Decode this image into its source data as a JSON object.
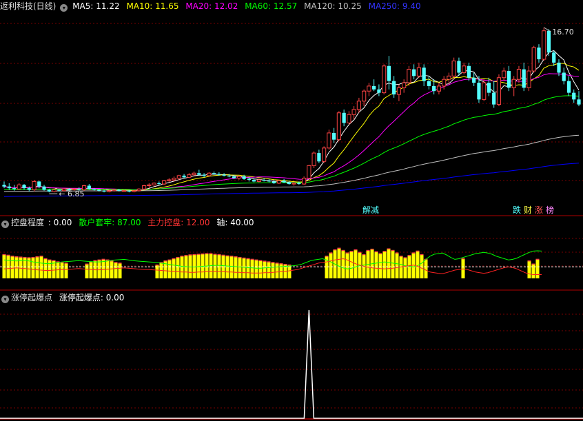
{
  "stock_name": "返利科技(日线)",
  "colors": {
    "bg": "#000000",
    "up": "#ff4444",
    "down": "#54ffff",
    "ma5": "#ffffff",
    "ma10": "#ffff00",
    "ma20": "#ff00ff",
    "ma60": "#00ff00",
    "ma120": "#c0c0c0",
    "ma250": "#0000ff",
    "grid": "#7a0000",
    "separator": "#b00000"
  },
  "top_legend": [
    {
      "label": "MA5: 11.22",
      "color": "#ffffff"
    },
    {
      "label": "MA10: 11.65",
      "color": "#ffff00"
    },
    {
      "label": "MA20: 12.02",
      "color": "#ff00ff"
    },
    {
      "label": "MA60: 12.57",
      "color": "#00ff00"
    },
    {
      "label": "MA120: 10.25",
      "color": "#c0c0c0"
    },
    {
      "label": "MA250: 9.40",
      "color": "#3333ff"
    }
  ],
  "mid_legend": {
    "title": "控盘程度",
    "items": [
      {
        "label": ": 0.00",
        "color": "#ffffff"
      },
      {
        "label": "散户套牢: 87.00",
        "color": "#00ff00"
      },
      {
        "label": "主力控盘: 12.00",
        "color": "#ff3333"
      },
      {
        "label": "轴: 40.00",
        "color": "#ffffff"
      }
    ]
  },
  "bot_legend": {
    "title": "涨停起爆点",
    "items": [
      {
        "label": "涨停起爆点: 0.00",
        "color": "#ffffff"
      }
    ]
  },
  "annotations": {
    "high_label": "16.70",
    "low_label": "6.85",
    "tag1": "解减",
    "tag2": [
      "跌",
      "财",
      "涨",
      "榜"
    ]
  },
  "chart_data": [
    {
      "type": "candlestick",
      "title": "返利科技(日线)",
      "ylim": [
        5.5,
        17.6
      ],
      "high": 16.7,
      "low": 6.85,
      "note": "ohlc = [open, high, low, close] per daily bar",
      "ohlc": [
        [
          7.3,
          7.5,
          7.1,
          7.2
        ],
        [
          7.2,
          7.4,
          7.0,
          7.1
        ],
        [
          7.1,
          7.3,
          6.95,
          7.05
        ],
        [
          7.05,
          7.4,
          7.0,
          7.3
        ],
        [
          7.3,
          7.35,
          7.0,
          7.1
        ],
        [
          7.1,
          7.2,
          6.9,
          7.0
        ],
        [
          7.0,
          7.6,
          6.9,
          7.5
        ],
        [
          7.5,
          7.55,
          7.1,
          7.2
        ],
        [
          7.2,
          7.3,
          6.95,
          7.0
        ],
        [
          7.0,
          7.05,
          6.85,
          6.9
        ],
        [
          6.9,
          7.05,
          6.85,
          7.0
        ],
        [
          7.0,
          7.05,
          6.9,
          6.95
        ],
        [
          6.95,
          7.1,
          6.9,
          7.05
        ],
        [
          7.05,
          7.1,
          6.95,
          7.0
        ],
        [
          7.0,
          7.1,
          6.95,
          7.05
        ],
        [
          7.05,
          7.15,
          6.95,
          7.0
        ],
        [
          7.0,
          7.3,
          6.95,
          7.25
        ],
        [
          7.25,
          7.35,
          7.0,
          7.05
        ],
        [
          7.05,
          7.1,
          6.95,
          7.0
        ],
        [
          7.0,
          7.05,
          6.9,
          6.95
        ],
        [
          6.95,
          7.0,
          6.85,
          6.9
        ],
        [
          6.9,
          7.0,
          6.85,
          6.95
        ],
        [
          6.95,
          7.05,
          6.9,
          7.0
        ],
        [
          7.0,
          7.05,
          6.9,
          6.95
        ],
        [
          6.95,
          7.0,
          6.9,
          6.95
        ],
        [
          6.95,
          7.0,
          6.85,
          6.9
        ],
        [
          6.9,
          7.0,
          6.85,
          6.95
        ],
        [
          6.95,
          7.1,
          6.9,
          7.05
        ],
        [
          7.05,
          7.3,
          7.0,
          7.25
        ],
        [
          7.25,
          7.4,
          7.1,
          7.3
        ],
        [
          7.3,
          7.45,
          7.2,
          7.4
        ],
        [
          7.4,
          7.5,
          7.3,
          7.35
        ],
        [
          7.35,
          7.6,
          7.3,
          7.55
        ],
        [
          7.55,
          7.7,
          7.45,
          7.6
        ],
        [
          7.6,
          7.8,
          7.5,
          7.7
        ],
        [
          7.7,
          7.9,
          7.6,
          7.85
        ],
        [
          7.85,
          7.95,
          7.7,
          7.75
        ],
        [
          7.75,
          8.0,
          7.7,
          7.9
        ],
        [
          7.9,
          8.1,
          7.8,
          8.0
        ],
        [
          8.0,
          8.2,
          7.85,
          7.9
        ],
        [
          7.9,
          8.0,
          7.75,
          7.85
        ],
        [
          7.85,
          8.05,
          7.8,
          8.0
        ],
        [
          8.0,
          8.1,
          7.9,
          7.95
        ],
        [
          7.95,
          8.05,
          7.85,
          7.9
        ],
        [
          7.9,
          8.0,
          7.8,
          7.85
        ],
        [
          7.85,
          7.95,
          7.75,
          7.8
        ],
        [
          7.8,
          7.9,
          7.65,
          7.7
        ],
        [
          7.7,
          7.85,
          7.6,
          7.8
        ],
        [
          7.8,
          7.9,
          7.6,
          7.65
        ],
        [
          7.65,
          7.75,
          7.5,
          7.6
        ],
        [
          7.6,
          7.7,
          7.45,
          7.5
        ],
        [
          7.5,
          7.65,
          7.45,
          7.6
        ],
        [
          7.6,
          7.7,
          7.5,
          7.55
        ],
        [
          7.55,
          7.65,
          7.45,
          7.5
        ],
        [
          7.5,
          7.6,
          7.35,
          7.4
        ],
        [
          7.4,
          7.6,
          7.35,
          7.55
        ],
        [
          7.55,
          7.65,
          7.4,
          7.45
        ],
        [
          7.45,
          7.55,
          7.3,
          7.35
        ],
        [
          7.35,
          7.45,
          7.25,
          7.4
        ],
        [
          7.4,
          7.5,
          7.3,
          7.35
        ],
        [
          7.35,
          7.8,
          7.3,
          7.7
        ],
        [
          7.7,
          8.5,
          7.65,
          8.45
        ],
        [
          8.45,
          9.3,
          8.3,
          9.2
        ],
        [
          9.2,
          9.4,
          8.6,
          8.7
        ],
        [
          8.7,
          9.6,
          8.6,
          9.5
        ],
        [
          9.5,
          10.6,
          9.4,
          10.4
        ],
        [
          10.4,
          10.7,
          9.8,
          10.0
        ],
        [
          10.0,
          11.7,
          9.9,
          11.6
        ],
        [
          11.6,
          11.8,
          10.8,
          11.0
        ],
        [
          11.0,
          11.7,
          10.9,
          11.5
        ],
        [
          11.5,
          12.0,
          11.2,
          11.8
        ],
        [
          11.8,
          12.5,
          11.6,
          12.3
        ],
        [
          12.3,
          13.0,
          12.0,
          12.9
        ],
        [
          12.9,
          13.4,
          12.6,
          13.2
        ],
        [
          13.2,
          13.6,
          12.9,
          13.0
        ],
        [
          13.0,
          13.3,
          12.6,
          12.8
        ],
        [
          12.8,
          14.5,
          12.7,
          14.4
        ],
        [
          14.4,
          15.0,
          13.0,
          13.5
        ],
        [
          13.5,
          13.8,
          12.5,
          12.7
        ],
        [
          12.7,
          13.3,
          12.3,
          13.1
        ],
        [
          13.1,
          13.6,
          12.8,
          13.4
        ],
        [
          13.4,
          14.4,
          13.2,
          14.2
        ],
        [
          14.2,
          14.5,
          13.6,
          13.8
        ],
        [
          13.8,
          14.6,
          13.7,
          14.3
        ],
        [
          14.3,
          14.5,
          13.2,
          13.5
        ],
        [
          13.5,
          13.8,
          13.0,
          13.2
        ],
        [
          13.2,
          13.6,
          12.7,
          12.9
        ],
        [
          12.9,
          13.4,
          12.7,
          13.2
        ],
        [
          13.2,
          13.8,
          13.0,
          13.6
        ],
        [
          13.6,
          14.0,
          13.3,
          13.8
        ],
        [
          13.8,
          14.9,
          13.6,
          14.7
        ],
        [
          14.7,
          14.9,
          13.8,
          14.0
        ],
        [
          14.0,
          14.6,
          13.9,
          14.4
        ],
        [
          14.4,
          14.6,
          13.5,
          13.7
        ],
        [
          13.7,
          14.0,
          13.2,
          13.4
        ],
        [
          13.4,
          13.8,
          12.2,
          12.4
        ],
        [
          12.4,
          13.6,
          12.3,
          13.4
        ],
        [
          13.4,
          13.7,
          12.6,
          12.8
        ],
        [
          12.8,
          13.5,
          11.9,
          12.1
        ],
        [
          12.1,
          13.9,
          12.0,
          13.7
        ],
        [
          13.7,
          14.3,
          13.5,
          14.1
        ],
        [
          14.1,
          14.4,
          12.9,
          13.1
        ],
        [
          13.1,
          13.8,
          12.6,
          13.6
        ],
        [
          13.6,
          14.4,
          13.4,
          14.2
        ],
        [
          14.2,
          14.6,
          12.9,
          13.1
        ],
        [
          13.1,
          14.4,
          12.9,
          14.1
        ],
        [
          14.1,
          15.6,
          14.0,
          15.5
        ],
        [
          15.5,
          15.7,
          14.6,
          14.8
        ],
        [
          14.8,
          16.7,
          14.7,
          16.5
        ],
        [
          16.5,
          16.6,
          15.0,
          15.2
        ],
        [
          15.2,
          15.3,
          14.4,
          14.6
        ],
        [
          14.6,
          14.8,
          13.8,
          14.0
        ],
        [
          14.0,
          14.3,
          13.3,
          13.5
        ],
        [
          13.5,
          13.8,
          12.6,
          12.8
        ],
        [
          12.8,
          13.0,
          12.2,
          12.4
        ],
        [
          12.4,
          12.9,
          12.0,
          12.1
        ]
      ],
      "series": [
        {
          "name": "MA5",
          "current": 11.22
        },
        {
          "name": "MA10",
          "current": 11.65
        },
        {
          "name": "MA20",
          "current": 12.02
        },
        {
          "name": "MA60",
          "current": 12.57
        },
        {
          "name": "MA120",
          "current": 10.25
        },
        {
          "name": "MA250",
          "current": 9.4
        }
      ]
    },
    {
      "type": "bar",
      "title": "控盘程度",
      "ylim": [
        0,
        110
      ],
      "axis_value": 40,
      "bars": [
        75,
        73,
        70,
        68,
        67,
        66,
        65,
        66,
        68,
        70,
        62,
        58,
        56,
        52,
        50,
        48,
        0,
        0,
        0,
        0,
        45,
        52,
        56,
        58,
        60,
        58,
        55,
        50,
        48,
        0,
        0,
        0,
        0,
        0,
        0,
        0,
        0,
        42,
        50,
        55,
        58,
        62,
        66,
        70,
        72,
        74,
        75,
        76,
        77,
        78,
        78,
        76,
        75,
        73,
        71,
        70,
        68,
        66,
        64,
        62,
        60,
        58,
        56,
        54,
        52,
        50,
        48,
        46,
        44,
        42,
        0,
        0,
        0,
        0,
        0,
        0,
        0,
        0,
        70,
        80,
        90,
        95,
        88,
        80,
        85,
        90,
        82,
        75,
        88,
        92,
        84,
        78,
        85,
        93,
        88,
        80,
        70,
        65,
        72,
        80,
        86,
        75,
        60,
        0,
        0,
        0,
        0,
        0,
        0,
        0,
        0,
        62,
        0,
        0,
        0,
        0,
        0,
        0,
        0,
        0,
        0,
        0,
        0,
        0,
        0,
        0,
        0,
        55,
        45,
        60,
        0,
        0,
        0,
        0,
        0,
        0,
        0,
        0,
        0,
        0
      ],
      "series": [
        {
          "name": "散户套牢",
          "current": 87.0,
          "values": [
            58,
            57,
            56,
            55,
            56,
            57,
            55,
            52,
            50,
            48,
            47,
            46,
            48,
            50,
            52,
            53,
            54,
            55,
            56,
            55,
            54,
            53,
            52,
            52,
            53,
            55,
            57,
            58,
            59,
            60,
            58,
            56,
            55,
            54,
            53,
            52,
            51,
            50,
            48,
            46,
            44,
            42,
            40,
            38,
            37,
            36,
            36,
            37,
            38,
            39,
            40,
            41,
            41,
            40,
            39,
            38,
            37,
            36,
            35,
            34,
            33,
            32,
            32,
            33,
            34,
            35,
            36,
            37,
            38,
            39,
            40,
            42,
            45,
            50,
            55,
            58,
            60,
            62,
            58,
            52,
            45,
            38,
            33,
            30,
            32,
            36,
            40,
            42,
            44,
            46,
            48,
            50,
            52,
            50,
            48,
            46,
            44,
            40,
            38,
            36,
            40,
            48,
            60,
            70,
            76,
            78,
            80,
            74,
            66,
            60,
            62,
            66,
            70,
            74,
            78,
            80,
            82,
            80,
            76,
            70,
            66,
            62,
            58,
            60,
            64,
            70,
            76,
            82,
            86,
            87,
            86
          ]
        },
        {
          "name": "主力控盘",
          "current": 12.0,
          "values": [
            30,
            31,
            32,
            33,
            32,
            31,
            30,
            28,
            27,
            26,
            25,
            25,
            26,
            27,
            28,
            28,
            29,
            30,
            31,
            30,
            29,
            28,
            27,
            27,
            28,
            29,
            30,
            31,
            32,
            33,
            32,
            31,
            30,
            29,
            28,
            28,
            27,
            26,
            25,
            24,
            23,
            22,
            21,
            20,
            20,
            19,
            19,
            20,
            20,
            21,
            22,
            22,
            22,
            21,
            20,
            20,
            19,
            19,
            18,
            18,
            17,
            17,
            17,
            18,
            18,
            19,
            20,
            21,
            22,
            24,
            26,
            28,
            32,
            36,
            40,
            44,
            48,
            50,
            52,
            55,
            58,
            60,
            62,
            58,
            52,
            46,
            42,
            38,
            35,
            33,
            32,
            31,
            30,
            31,
            32,
            34,
            36,
            38,
            40,
            42,
            38,
            32,
            26,
            20,
            18,
            16,
            15,
            18,
            22,
            26,
            28,
            30,
            28,
            24,
            20,
            18,
            16,
            18,
            22,
            26,
            30,
            34,
            36,
            34,
            30,
            24,
            18,
            14,
            12,
            12,
            12
          ]
        }
      ]
    },
    {
      "type": "line",
      "title": "涨停起爆点",
      "ylim": [
        0,
        1.05
      ],
      "current": 0.0,
      "spike_index": 61,
      "spike_value": 1
    }
  ]
}
